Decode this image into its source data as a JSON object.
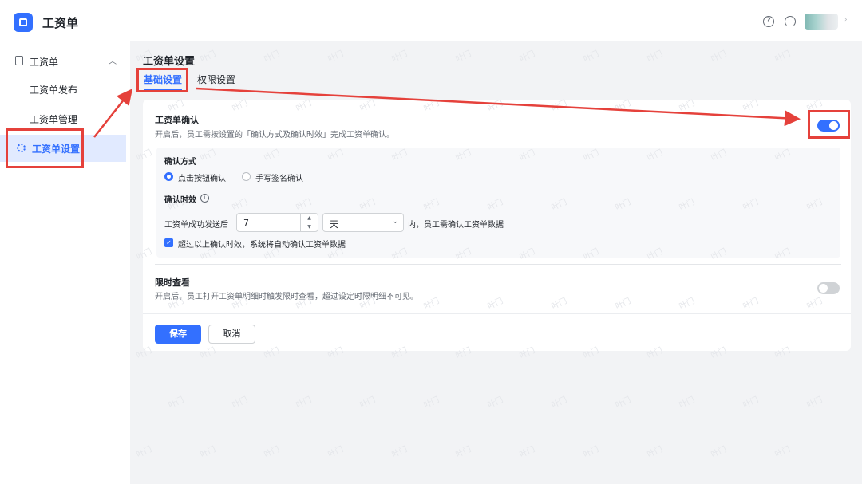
{
  "header": {
    "app_title": "工资单",
    "logo_icon": "app-logo-icon",
    "help_icon": "help-circle-icon",
    "support_icon": "headset-icon"
  },
  "sidebar": {
    "group": {
      "label": "工资单",
      "icon": "document-icon"
    },
    "items": [
      {
        "label": "工资单发布"
      },
      {
        "label": "工资单管理"
      },
      {
        "label": "工资单设置",
        "icon": "gear-icon",
        "active": true
      }
    ]
  },
  "main": {
    "page_title": "工资单设置",
    "tabs": [
      {
        "label": "基础设置",
        "active": true
      },
      {
        "label": "权限设置",
        "active": false
      }
    ],
    "confirm_section": {
      "title": "工资单确认",
      "desc": "开启后，员工需按设置的「确认方式及确认时效」完成工资单确认。",
      "enabled": true,
      "method_label": "确认方式",
      "methods": [
        {
          "label": "点击按钮确认",
          "checked": true
        },
        {
          "label": "手写签名确认",
          "checked": false
        }
      ],
      "timeout_label": "确认时效",
      "timeout_prefix": "工资单成功发送后",
      "timeout_value": "7",
      "unit_value": "天",
      "timeout_suffix": "内，员工需确认工资单数据",
      "auto_confirm_label": "超过以上确认时效，系统将自动确认工资单数据",
      "auto_confirm_checked": true
    },
    "limit_section": {
      "title": "限时查看",
      "desc": "开启后，员工打开工资单明细时触发限时查看，超过设定时限明细不可见。",
      "enabled": false
    },
    "buttons": {
      "save": "保存",
      "cancel": "取消"
    }
  },
  "watermark": "叶门",
  "colors": {
    "accent": "#3370ff",
    "annotation": "#e5413b",
    "active_bg": "#e1eaff"
  }
}
